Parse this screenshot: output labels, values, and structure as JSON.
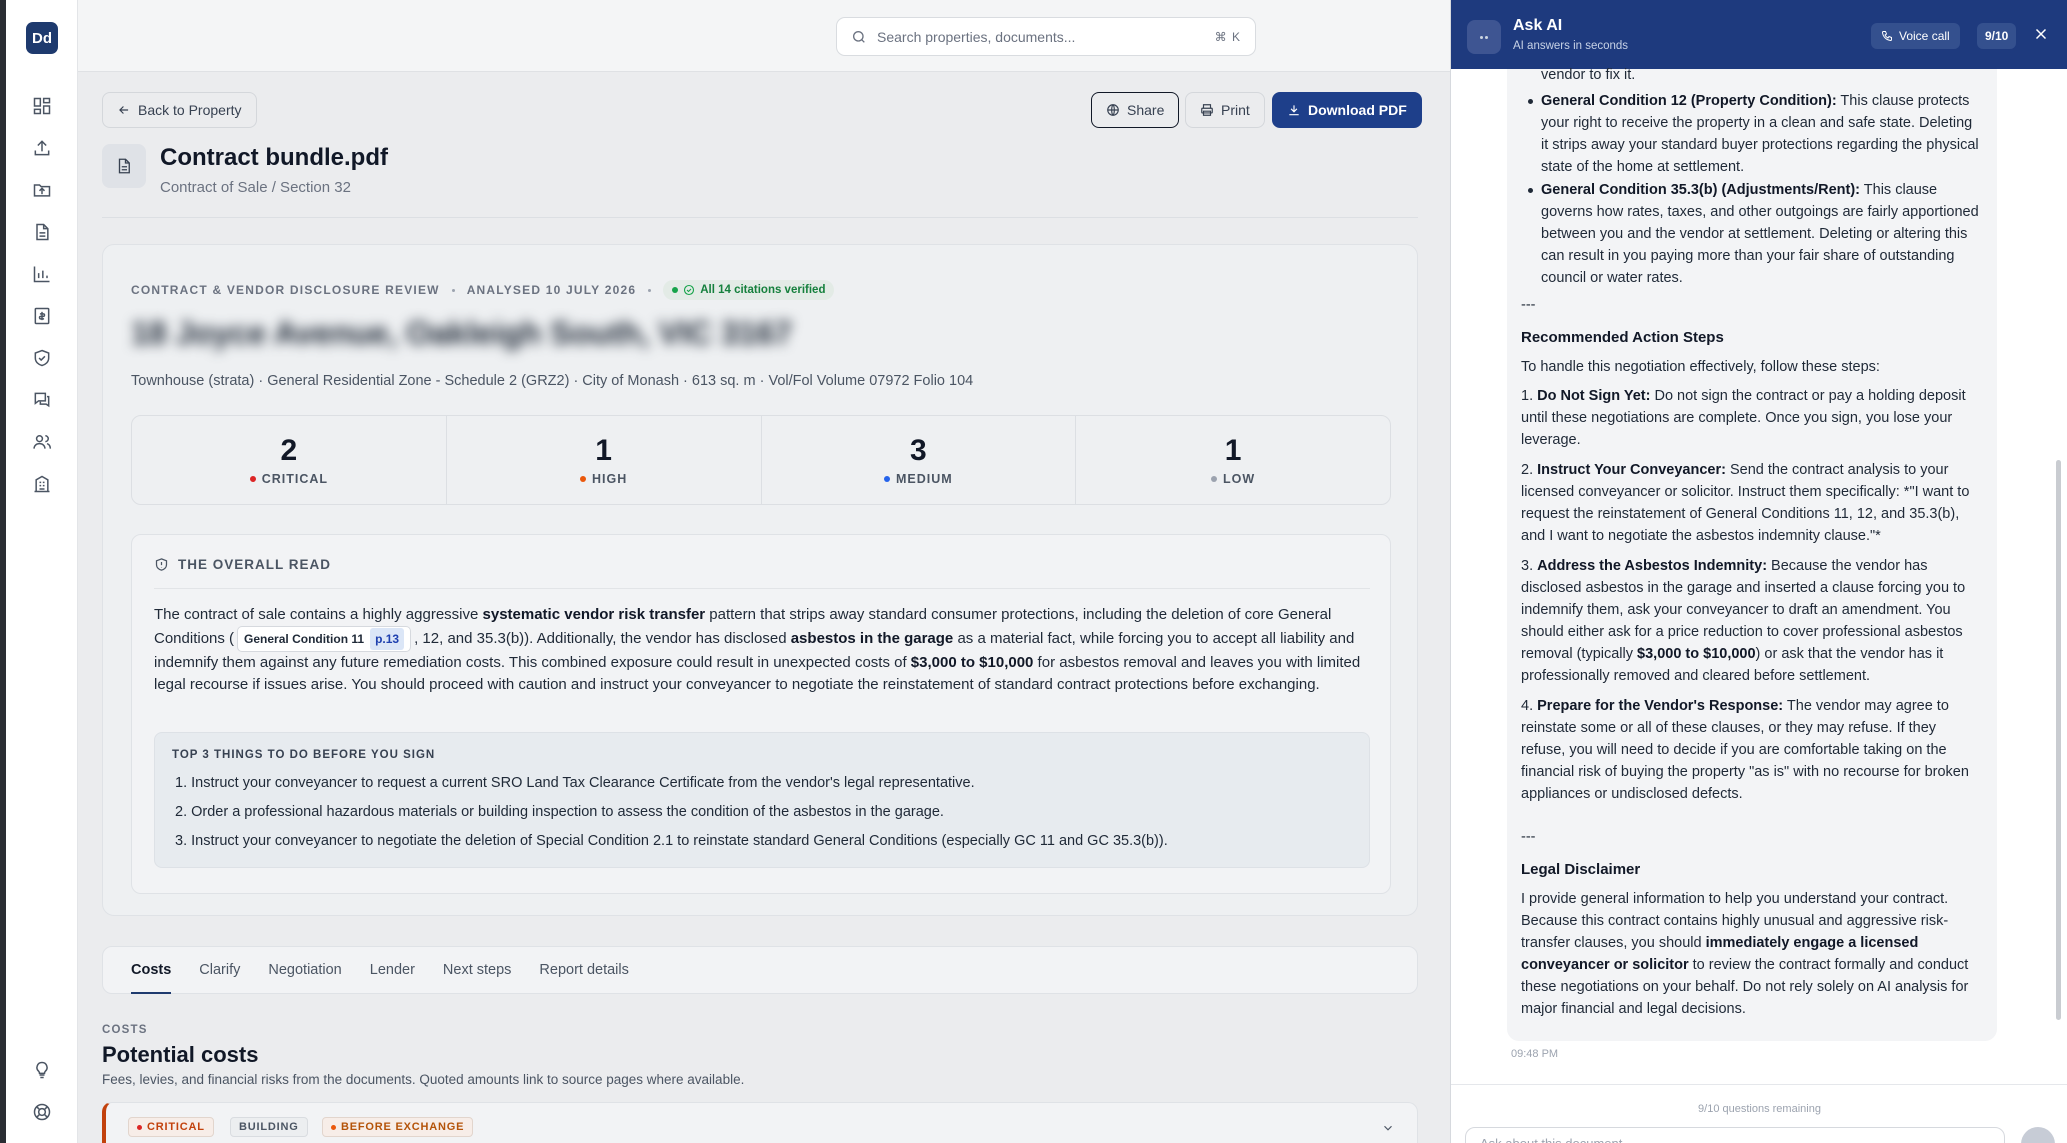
{
  "sidebar": {
    "logo": "Dd",
    "icons": [
      "dashboard-icon",
      "upload-icon",
      "folder-upload-icon",
      "document-icon",
      "chart-icon",
      "invoice-icon",
      "shield-check-icon",
      "chat-icon",
      "users-icon",
      "building-icon",
      "lightbulb-icon",
      "lifebuoy-icon"
    ]
  },
  "search": {
    "placeholder": "Search properties, documents...",
    "shortcut": "⌘ K"
  },
  "toolbar": {
    "back": "Back to Property",
    "share": "Share",
    "print": "Print",
    "download": "Download PDF"
  },
  "document": {
    "title": "Contract bundle.pdf",
    "subtitle": "Contract of Sale / Section 32"
  },
  "review": {
    "kicker": "CONTRACT & VENDOR DISCLOSURE REVIEW",
    "analysed": "ANALYSED 10 JULY 2026",
    "verified": "All 14 citations verified",
    "address": "18 Joyce Avenue, Oakleigh South, VIC 3167",
    "property_line": "Townhouse (strata) · General Residential Zone - Schedule 2 (GRZ2) · City of Monash · 613 sq. m · Vol/Fol Volume 07972 Folio 104",
    "counts": [
      {
        "num": "2",
        "label": "CRITICAL",
        "color": "#dc2626"
      },
      {
        "num": "1",
        "label": "HIGH",
        "color": "#ea580c"
      },
      {
        "num": "3",
        "label": "MEDIUM",
        "color": "#2563eb"
      },
      {
        "num": "1",
        "label": "LOW",
        "color": "#9ca3af"
      }
    ]
  },
  "overall": {
    "heading": "THE OVERALL READ",
    "p1": "The contract of sale contains a highly aggressive ",
    "b1": "systematic vendor risk transfer",
    "p2": " pattern that strips away standard consumer protections, including the deletion of core General Conditions (",
    "cite_label": "General Condition 11",
    "cite_page": "p.13",
    "p3": ", 12, and 35.3(b)). Additionally, the vendor has disclosed ",
    "b2": "asbestos in the garage",
    "p4": " as a material fact, while forcing you to accept all liability and indemnify them against any future remediation costs. This combined exposure could result in unexpected costs of ",
    "b3": "$3,000 to $10,000",
    "p5": " for asbestos removal and leaves you with limited legal recourse if issues arise. You should proceed with caution and instruct your conveyancer to negotiate the reinstatement of standard contract protections before exchanging.",
    "top3_heading": "TOP 3 THINGS TO DO BEFORE YOU SIGN",
    "top3": [
      "1. Instruct your conveyancer to request a current SRO Land Tax Clearance Certificate from the vendor's legal representative.",
      "2. Order a professional hazardous materials or building inspection to assess the condition of the asbestos in the garage.",
      "3. Instruct your conveyancer to negotiate the deletion of Special Condition 2.1 to reinstate standard General Conditions (especially GC 11 and GC 35.3(b))."
    ]
  },
  "tabs": [
    "Costs",
    "Clarify",
    "Negotiation",
    "Lender",
    "Next steps",
    "Report details"
  ],
  "costs": {
    "kicker": "COSTS",
    "title": "Potential costs",
    "desc": "Fees, levies, and financial risks from the documents. Quoted amounts link to source pages where available.",
    "badges": [
      "CRITICAL",
      "BUILDING",
      "BEFORE EXCHANGE"
    ]
  },
  "ai": {
    "title": "Ask AI",
    "subtitle": "AI answers in seconds",
    "voice": "Voice call",
    "quota": "9/10",
    "time": "09:48 PM",
    "remaining": "9/10 questions remaining",
    "input_placeholder": "Ask about this document...",
    "top_fragment": "vendor to fix it.",
    "b_gc12": "General Condition 12 (Property Condition):",
    "t_gc12": " This clause protects your right to receive the property in a clean and safe state. Deleting it strips away your standard buyer protections regarding the physical state of the home at settlement.",
    "b_gc35": "General Condition 35.3(b) (Adjustments/Rent):",
    "t_gc35": " This clause governs how rates, taxes, and other outgoings are fairly apportioned between you and the vendor at settlement. Deleting or altering this can result in you paying more than your fair share of outstanding council or water rates.",
    "sep": "---",
    "h_action": "Recommended Action Steps",
    "intro": "To handle this negotiation effectively, follow these steps:",
    "s1b": "Do Not Sign Yet:",
    "s1": " Do not sign the contract or pay a holding deposit until these negotiations are complete. Once you sign, you lose your leverage.",
    "s2b": "Instruct Your Conveyancer:",
    "s2": " Send the contract analysis to your licensed conveyancer or solicitor. Instruct them specifically: *\"I want to request the reinstatement of General Conditions 11, 12, and 35.3(b), and I want to negotiate the asbestos indemnity clause.\"*",
    "s3b": "Address the Asbestos Indemnity:",
    "s3": " Because the vendor has disclosed asbestos in the garage and inserted a clause forcing you to indemnify them, ask your conveyancer to draft an amendment. You should either ask for a price reduction to cover professional asbestos removal (typically ",
    "s3c": "$3,000 to $10,000",
    "s3d": ") or ask that the vendor has it professionally removed and cleared before settlement.",
    "s4b": "Prepare for the Vendor's Response:",
    "s4": " The vendor may agree to reinstate some or all of these clauses, or they may refuse. If they refuse, you will need to decide if you are comfortable taking on the financial risk of buying the property \"as is\" with no recourse for broken appliances or undisclosed defects.",
    "h_legal": "Legal Disclaimer",
    "legal1": "I provide general information to help you understand your contract. Because this contract contains highly unusual and aggressive risk-transfer clauses, you should ",
    "legal_b": "immediately engage a licensed conveyancer or solicitor",
    "legal2": " to review the contract formally and conduct these negotiations on your behalf. Do not rely solely on AI analysis for major financial and legal decisions."
  }
}
